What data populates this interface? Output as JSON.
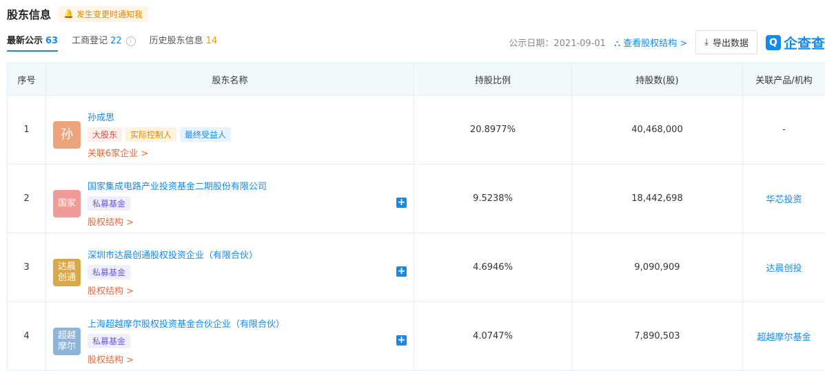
{
  "header": {
    "title": "股东信息",
    "notify": "发生变更时通知我"
  },
  "tabs": [
    {
      "label": "最新公示",
      "count": "63"
    },
    {
      "label": "工商登记",
      "count": "22"
    },
    {
      "label": "历史股东信息",
      "count": "14"
    }
  ],
  "toolbar": {
    "pub_date": "公示日期：2021-09-01",
    "equity_link": "查看股权结构 >",
    "export_label": "导出数据",
    "logo_text": "企查查"
  },
  "table": {
    "columns": [
      "序号",
      "股东名称",
      "持股比例",
      "持股数(股)",
      "关联产品/机构"
    ],
    "rows": [
      {
        "index": "1",
        "avatar": "孙",
        "avatar_color": "#eba47c",
        "name": "孙成思",
        "tags": [
          "大股东",
          "实际控制人",
          "最终受益人"
        ],
        "link": "关联6家企业 >",
        "ratio": "20.8977%",
        "shares": "40,468,000",
        "product": "-"
      },
      {
        "index": "2",
        "avatar": "国家",
        "avatar_color": "#f09b98",
        "name": "国家集成电路产业投资基金二期股份有限公司",
        "tags": [
          "私募基金"
        ],
        "link": "股权结构 >",
        "ratio": "9.5238%",
        "shares": "18,442,698",
        "product": "华芯投资"
      },
      {
        "index": "3",
        "avatar": "达晨\n创通",
        "avatar_color": "#d9a848",
        "name": "深圳市达晨创通股权投资企业（有限合伙）",
        "tags": [
          "私募基金"
        ],
        "link": "股权结构 >",
        "ratio": "4.6946%",
        "shares": "9,090,909",
        "product": "达晨创投"
      },
      {
        "index": "4",
        "avatar": "超越\n摩尔",
        "avatar_color": "#8fb4dc",
        "name": "上海超越摩尔股权投资基金合伙企业（有限合伙）",
        "tags": [
          "私募基金"
        ],
        "link": "股权结构 >",
        "ratio": "4.0747%",
        "shares": "7,890,503",
        "product": "超越摩尔基金"
      }
    ]
  }
}
